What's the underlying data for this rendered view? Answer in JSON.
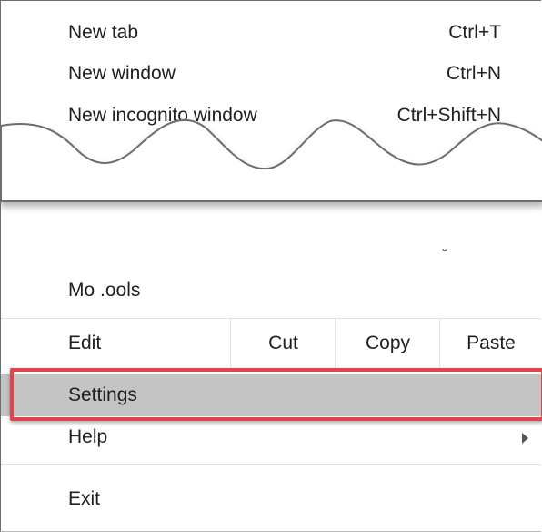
{
  "menu": {
    "top_items": [
      {
        "label": "New tab",
        "shortcut": "Ctrl+T"
      },
      {
        "label": "New window",
        "shortcut": "Ctrl+N"
      },
      {
        "label": "New incognito window",
        "shortcut": "Ctrl+Shift+N"
      }
    ],
    "more_tools_label": "Mo  .ools",
    "edit": {
      "label": "Edit",
      "cut": "Cut",
      "copy": "Copy",
      "paste": "Paste"
    },
    "settings_label": "Settings",
    "help_label": "Help",
    "exit_label": "Exit"
  },
  "colors": {
    "highlight_border": "#e2444d",
    "selected_row": "#c4c4c4"
  },
  "icons": {
    "submenu": "chevron-right-icon"
  }
}
